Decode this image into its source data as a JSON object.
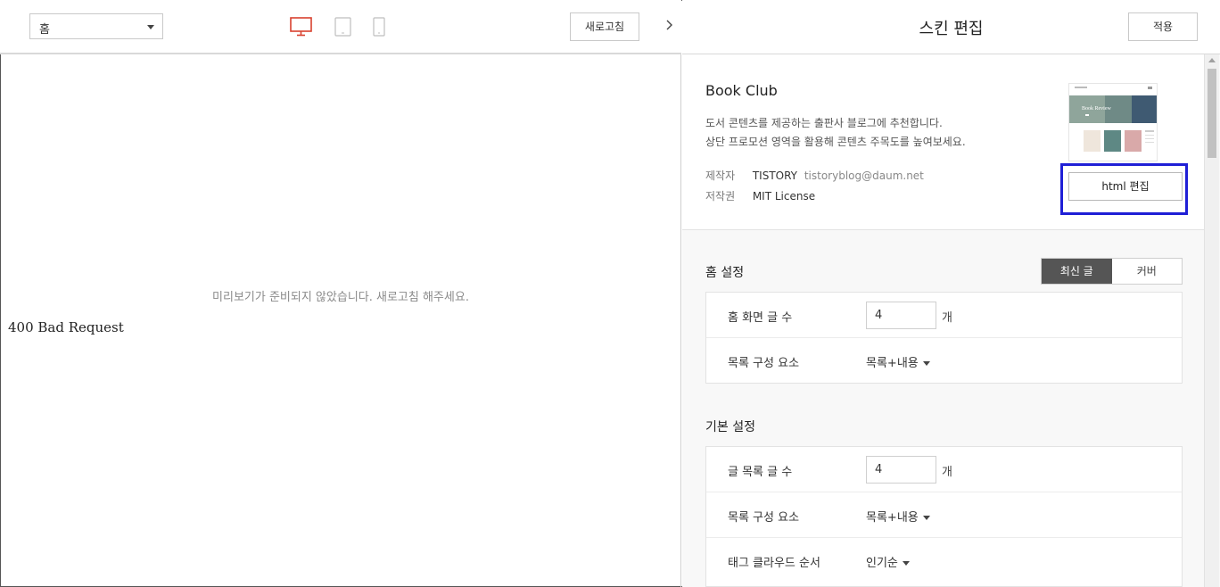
{
  "left_toolbar": {
    "page_select": "홈",
    "refresh_label": "새로고침",
    "devices": [
      "desktop-icon",
      "tablet-icon",
      "mobile-icon"
    ],
    "collapse_icon": "chevron-right-icon"
  },
  "preview": {
    "message": "미리보기가 준비되지 않았습니다. 새로고침 해주세요.",
    "error": "400 Bad Request"
  },
  "right_header": {
    "title": "스킨 편집",
    "apply_label": "적용"
  },
  "skin": {
    "name": "Book Club",
    "desc_line1": "도서 콘텐츠를 제공하는 출판사 블로그에 추천합니다.",
    "desc_line2": "상단 프로모션 영역을 활용해 콘텐츠 주목도를 높여보세요.",
    "author_label": "제작자",
    "author_value": "TISTORY",
    "author_email": "tistoryblog@daum.net",
    "license_label": "저작권",
    "license_value": "MIT License",
    "thumb_banner_text": "Book Review",
    "html_edit_label": "html 편집"
  },
  "home_settings": {
    "title": "홈 설정",
    "tabs": [
      {
        "label": "최신 글",
        "active": true
      },
      {
        "label": "커버",
        "active": false
      }
    ],
    "rows": {
      "post_count_label": "홈 화면 글 수",
      "post_count_value": "4",
      "post_count_unit": "개",
      "list_elements_label": "목록 구성 요소",
      "list_elements_value": "목록+내용"
    }
  },
  "basic_settings": {
    "title": "기본 설정",
    "rows": {
      "post_count_label": "글 목록 글 수",
      "post_count_value": "4",
      "post_count_unit": "개",
      "list_elements_label": "목록 구성 요소",
      "list_elements_value": "목록+내용",
      "tag_order_label": "태그 클라우드 순서",
      "tag_order_value": "인기순"
    }
  },
  "colors": {
    "active_device": "#d9412f",
    "inactive_device": "#bdbdbd",
    "highlight": "#1f1fd6",
    "active_tab": "#555555"
  }
}
